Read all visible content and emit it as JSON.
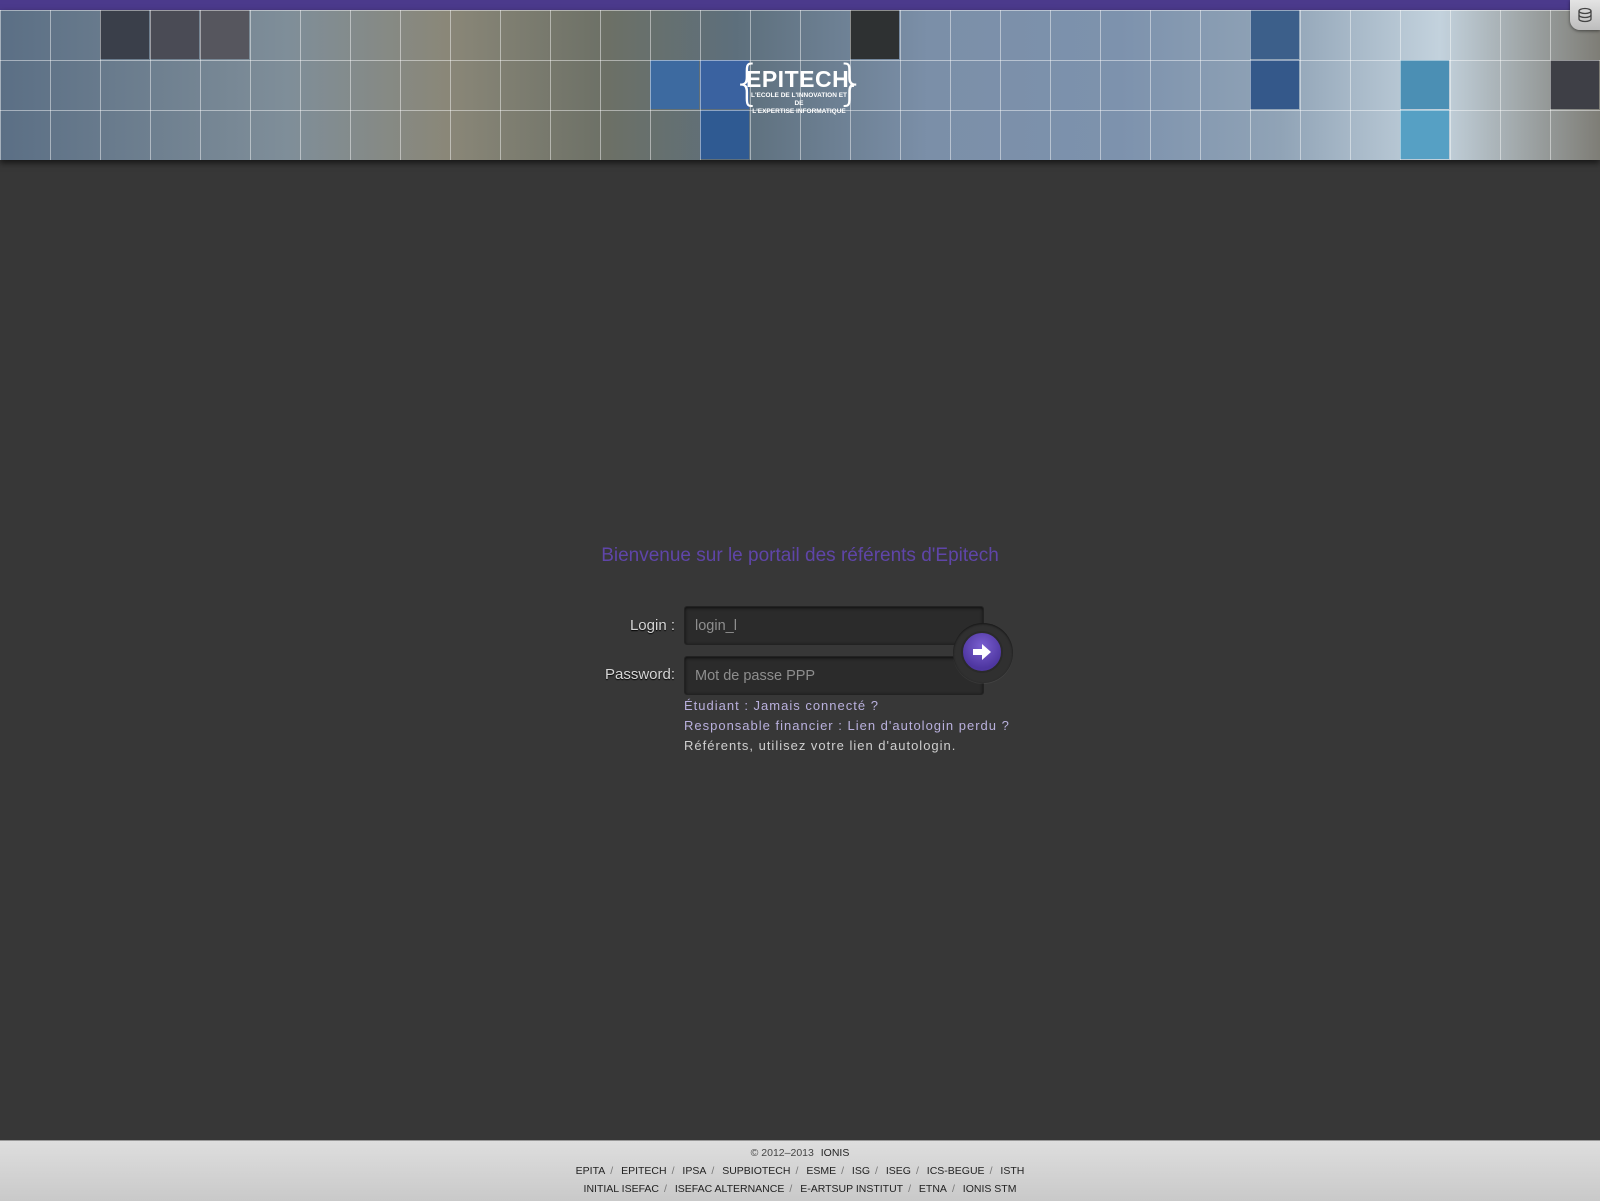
{
  "header": {
    "logo": {
      "name": "EPITECH.",
      "tagline_line1": "L'ECOLE DE L'INNOVATION ET DE",
      "tagline_line2": "L'EXPERTISE INFORMATIQUE"
    },
    "corner_icon": "stack-icon",
    "accent_color": "#4b3a8c"
  },
  "login": {
    "welcome": "Bienvenue sur le portail des référents d'Epitech",
    "login_label": "Login :",
    "login_placeholder": "login_l",
    "password_label": "Password:",
    "password_placeholder": "Mot de passe PPP",
    "submit_icon": "arrow-right-icon",
    "links": {
      "student": "Étudiant : Jamais connecté ?",
      "financial": "Responsable financier : Lien d'autologin perdu ?"
    },
    "info": "Référents, utilisez votre lien d'autologin."
  },
  "footer": {
    "copyright": "© 2012–2013",
    "brand": "IONIS",
    "row1": [
      "EPITA",
      "EPITECH",
      "IPSA",
      "SUPBIOTECH",
      "ESME",
      "ISG",
      "ISEG",
      "ICS-BEGUE",
      "ISTH"
    ],
    "row2": [
      "INITIAL ISEFAC",
      "ISEFAC ALTERNANCE",
      "E-ARTSUP INSTITUT",
      "ETNA",
      "IONIS STM"
    ]
  }
}
